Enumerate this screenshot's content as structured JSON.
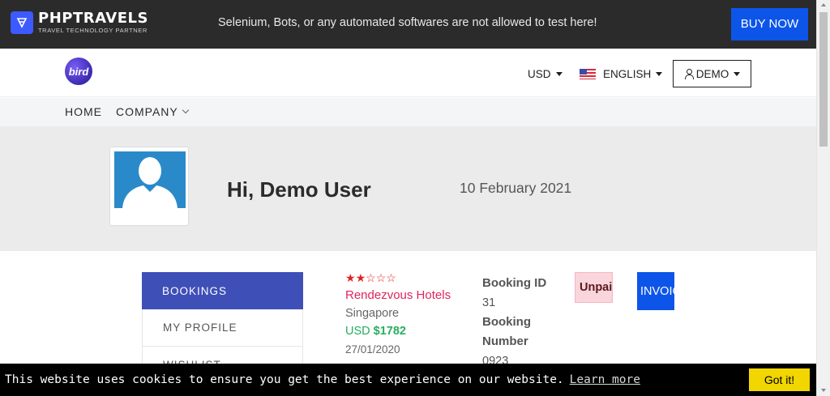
{
  "topbar": {
    "brand_name": "PHPTRAVELS",
    "brand_tagline": "TRAVEL TECHNOLOGY PARTNER",
    "notice": "Selenium, Bots, or any automated softwares are not allowed to test here!",
    "buy_now": "BUY NOW"
  },
  "header": {
    "logo_text": "bird",
    "currency": "USD",
    "language": "ENGLISH",
    "account": "DEMO"
  },
  "nav": {
    "items": [
      {
        "label": "HOME"
      },
      {
        "label": "COMPANY"
      }
    ]
  },
  "profile": {
    "greeting": "Hi, Demo User",
    "date": "10 February 2021"
  },
  "sidebar": {
    "items": [
      {
        "label": "BOOKINGS",
        "active": true
      },
      {
        "label": "MY PROFILE",
        "active": false
      },
      {
        "label": "WISHLIST",
        "active": false
      }
    ]
  },
  "booking": {
    "rating": 2,
    "rating_max": 5,
    "hotel_name": "Rendezvous Hotels",
    "city": "Singapore",
    "currency": "USD",
    "price": "$1782",
    "date": "27/01/2020",
    "id_label": "Booking ID",
    "id_value": "31",
    "number_label_1": "Booking",
    "number_label_2": "Number",
    "number_value": "0923",
    "status": "Unpaid",
    "invoice_label": "INVOICE"
  },
  "cookie": {
    "text": "This website uses cookies to ensure you get the best experience on our website.",
    "link": "Learn more",
    "button": "Got it!"
  },
  "colors": {
    "accent_blue": "#0d55e9",
    "sidebar_active": "#3f4fb8",
    "hotel_name": "#e0245e",
    "price_green": "#27ae60",
    "cookie_button": "#f1d600"
  }
}
